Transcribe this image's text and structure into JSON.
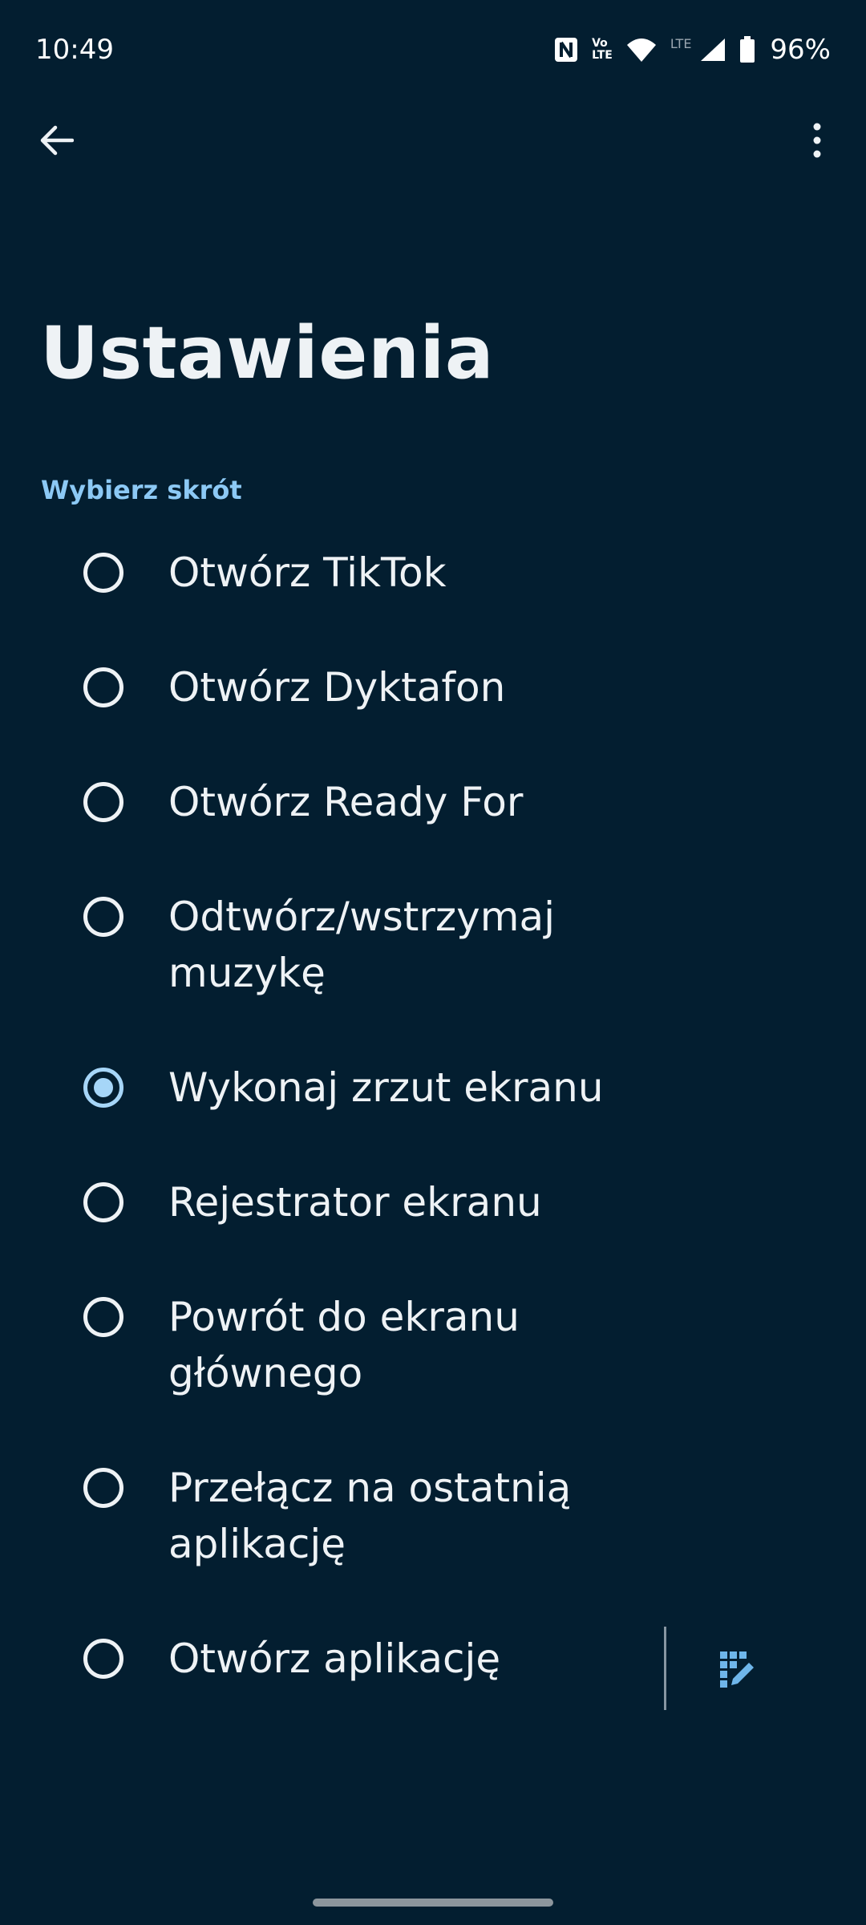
{
  "status_bar": {
    "time": "10:49",
    "volte_top": "Vo",
    "volte_bottom": "LTE",
    "lte_label": "LTE",
    "battery": "96%"
  },
  "toolbar": {
    "back_icon": "arrow-back-icon",
    "more_icon": "more-vert-icon"
  },
  "title": "Ustawienia",
  "section_header": "Wybierz skrót",
  "options": [
    {
      "label": "Otwórz TikTok",
      "checked": false
    },
    {
      "label": "Otwórz Dyktafon",
      "checked": false
    },
    {
      "label": "Otwórz Ready For",
      "checked": false
    },
    {
      "label": "Odtwórz/wstrzymaj muzykę",
      "checked": false
    },
    {
      "label": "Wykonaj zrzut ekranu",
      "checked": true
    },
    {
      "label": "Rejestrator ekranu",
      "checked": false
    },
    {
      "label": "Powrót do ekranu głównego",
      "checked": false
    },
    {
      "label": "Przełącz na ostatnią aplikację",
      "checked": false
    },
    {
      "label": "Otwórz aplikację",
      "checked": false
    }
  ],
  "edit_icon": "edit-grid-icon",
  "colors": {
    "background": "#031e30",
    "accent": "#8cc9f5",
    "text": "#eef2f5"
  }
}
